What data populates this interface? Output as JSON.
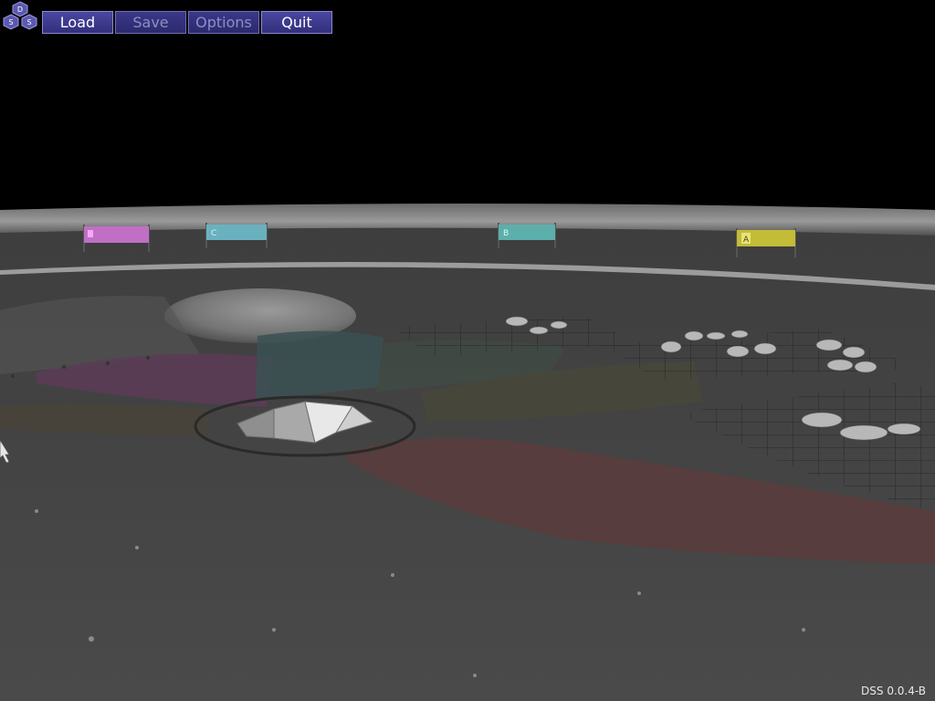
{
  "logo": {
    "letters": [
      "D",
      "S",
      "S"
    ]
  },
  "menu": {
    "load": "Load",
    "save": "Save",
    "options": "Options",
    "quit": "Quit"
  },
  "signs": [
    {
      "letter": "",
      "color": "#d47ad6"
    },
    {
      "letter": "C",
      "color": "#6bb6c4"
    },
    {
      "letter": "B",
      "color": "#5fb3ae"
    },
    {
      "letter": "A",
      "color": "#c9c23a"
    }
  ],
  "version": "DSS 0.0.4-B",
  "colors": {
    "menu_bg": "#3d3a8e",
    "menu_border": "#8a88c8",
    "sky": "#000000",
    "ground": "#474747"
  }
}
